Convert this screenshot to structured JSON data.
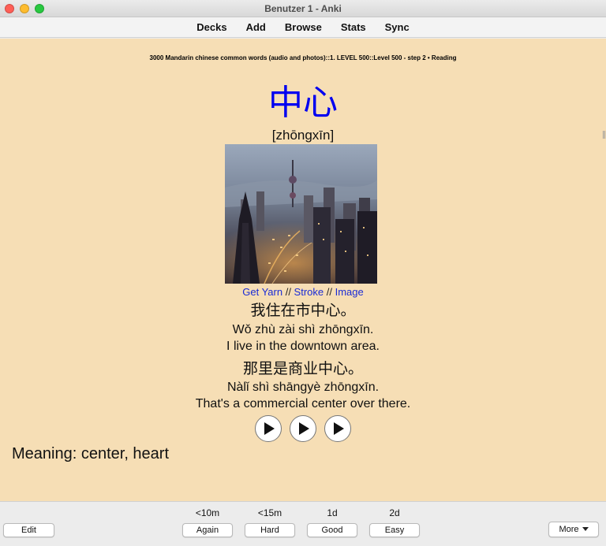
{
  "window": {
    "title": "Benutzer 1 - Anki"
  },
  "toolbar": {
    "items": [
      "Decks",
      "Add",
      "Browse",
      "Stats",
      "Sync"
    ]
  },
  "card": {
    "background_color": "#f6deb5",
    "deck_path": "3000 Mandarin chinese common words (audio and photos)::1. LEVEL 500::Level 500 - step 2 • Reading",
    "word": "中心",
    "word_color": "#0000f0",
    "pinyin": "[zhōngxīn]",
    "image_icon": "city-skyline-photo",
    "links": {
      "get_yarn": "Get Yarn",
      "sep1": " // ",
      "stroke": "Stroke",
      "sep2": " // ",
      "image": "Image",
      "link_color": "#1a2bd6"
    },
    "examples": [
      {
        "chinese": "我住在市中心。",
        "pinyin": "Wǒ zhù zài shì zhōngxīn.",
        "english": "I live in the downtown area."
      },
      {
        "chinese": "那里是商业中心。",
        "pinyin": "Nàlǐ shì shāngyè zhōngxīn.",
        "english": "That's a commercial center over there."
      }
    ],
    "audio_buttons": [
      "play-icon",
      "play-icon",
      "play-icon"
    ],
    "meaning": "Meaning: center, heart"
  },
  "answer_bar": {
    "edit_label": "Edit",
    "more_label": "More",
    "buttons": [
      {
        "interval": "<10m",
        "label": "Again"
      },
      {
        "interval": "<15m",
        "label": "Hard"
      },
      {
        "interval": "1d",
        "label": "Good"
      },
      {
        "interval": "2d",
        "label": "Easy"
      }
    ]
  }
}
